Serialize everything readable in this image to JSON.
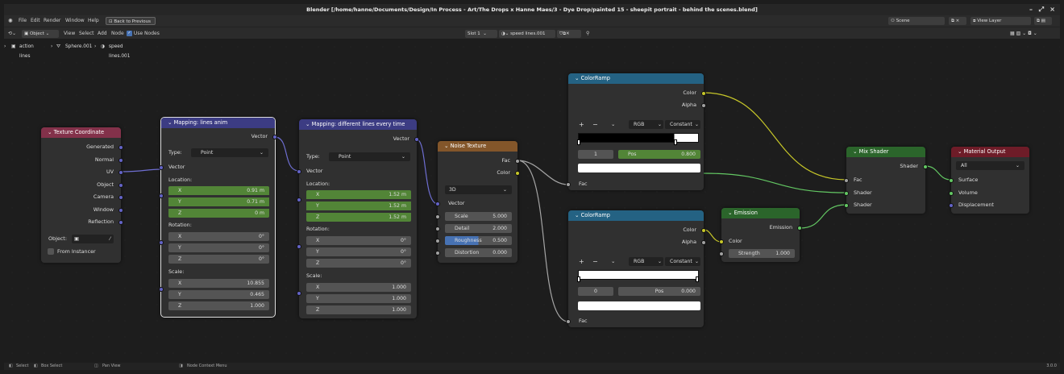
{
  "window": {
    "title": "Blender [/home/hanne/Documents/Design/In Process - Art/The Drops x Hanne Maes/3 - Dye Drop/painted 15 - sheepit portrait - behind the scenes.blend]",
    "min": "–",
    "max": "⤢",
    "close": "×"
  },
  "menu": {
    "items": [
      "File",
      "Edit",
      "Render",
      "Window",
      "Help"
    ],
    "back": "Back to Previous",
    "scene": "Scene",
    "view_layer": "View Layer"
  },
  "header": {
    "mode": "Object",
    "view": "View",
    "select": "Select",
    "add": "Add",
    "node": "Node",
    "use_nodes": "Use Nodes",
    "slot": "Slot 1",
    "material": "speed lines.001"
  },
  "breadcrumb": [
    "action lines",
    "Sphere.001",
    "speed lines.001"
  ],
  "status": {
    "select": "Select",
    "box": "Box Select",
    "pan": "Pan View",
    "ctx": "Node Context Menu",
    "version": "3.0.0"
  },
  "colors": {
    "input": "#83314a",
    "vector": "#3c3c83",
    "texture": "#83562a",
    "converter": "#246283",
    "shader": "#2b652b",
    "output": "#6e1c28"
  },
  "nodes": {
    "texcoord": {
      "title": "Texture Coordinate",
      "outputs": [
        "Generated",
        "Normal",
        "UV",
        "Object",
        "Camera",
        "Window",
        "Reflection"
      ],
      "object": "Object:",
      "from_instancer": "From Instancer"
    },
    "map1": {
      "title": "Mapping: lines anim",
      "vector_out": "Vector",
      "type_label": "Type:",
      "type": "Point",
      "vector_in": "Vector",
      "location": "Location:",
      "loc": [
        "0.91 m",
        "0.71 m",
        "0 m"
      ],
      "rotation": "Rotation:",
      "rot": [
        "0°",
        "0°",
        "0°"
      ],
      "scale": "Scale:",
      "scl": [
        "10.855",
        "0.465",
        "1.000"
      ],
      "x": "X",
      "y": "Y",
      "z": "Z"
    },
    "map2": {
      "title": "Mapping: different lines every time",
      "vector_out": "Vector",
      "type_label": "Type:",
      "type": "Point",
      "vector_in": "Vector",
      "location": "Location:",
      "loc": [
        "1.52 m",
        "1.52 m",
        "1.52 m"
      ],
      "rotation": "Rotation:",
      "rot": [
        "0°",
        "0°",
        "0°"
      ],
      "scale": "Scale:",
      "scl": [
        "1.000",
        "1.000",
        "1.000"
      ],
      "x": "X",
      "y": "Y",
      "z": "Z"
    },
    "noise": {
      "title": "Noise Texture",
      "fac": "Fac",
      "color": "Color",
      "dim": "3D",
      "vector": "Vector",
      "scale_l": "Scale",
      "scale_v": "5.000",
      "detail_l": "Detail",
      "detail_v": "2.000",
      "rough_l": "Roughness",
      "rough_v": "0.500",
      "dist_l": "Distortion",
      "dist_v": "0.000",
      "roughness": 0.5
    },
    "ramp1": {
      "title": "ColorRamp",
      "color": "Color",
      "alpha": "Alpha",
      "mode": "RGB",
      "interp": "Constant",
      "index": "1",
      "pos_l": "Pos",
      "pos_v": "0.800",
      "fac": "Fac"
    },
    "ramp2": {
      "title": "ColorRamp",
      "color": "Color",
      "alpha": "Alpha",
      "mode": "RGB",
      "interp": "Constant",
      "index": "0",
      "pos_l": "Pos",
      "pos_v": "0.000",
      "fac": "Fac"
    },
    "emission": {
      "title": "Emission",
      "out": "Emission",
      "color": "Color",
      "strength_l": "Strength",
      "strength_v": "1.000"
    },
    "mix": {
      "title": "Mix Shader",
      "out": "Shader",
      "fac": "Fac",
      "s1": "Shader",
      "s2": "Shader"
    },
    "output": {
      "title": "Material Output",
      "target": "All",
      "surface": "Surface",
      "volume": "Volume",
      "displacement": "Displacement"
    }
  }
}
